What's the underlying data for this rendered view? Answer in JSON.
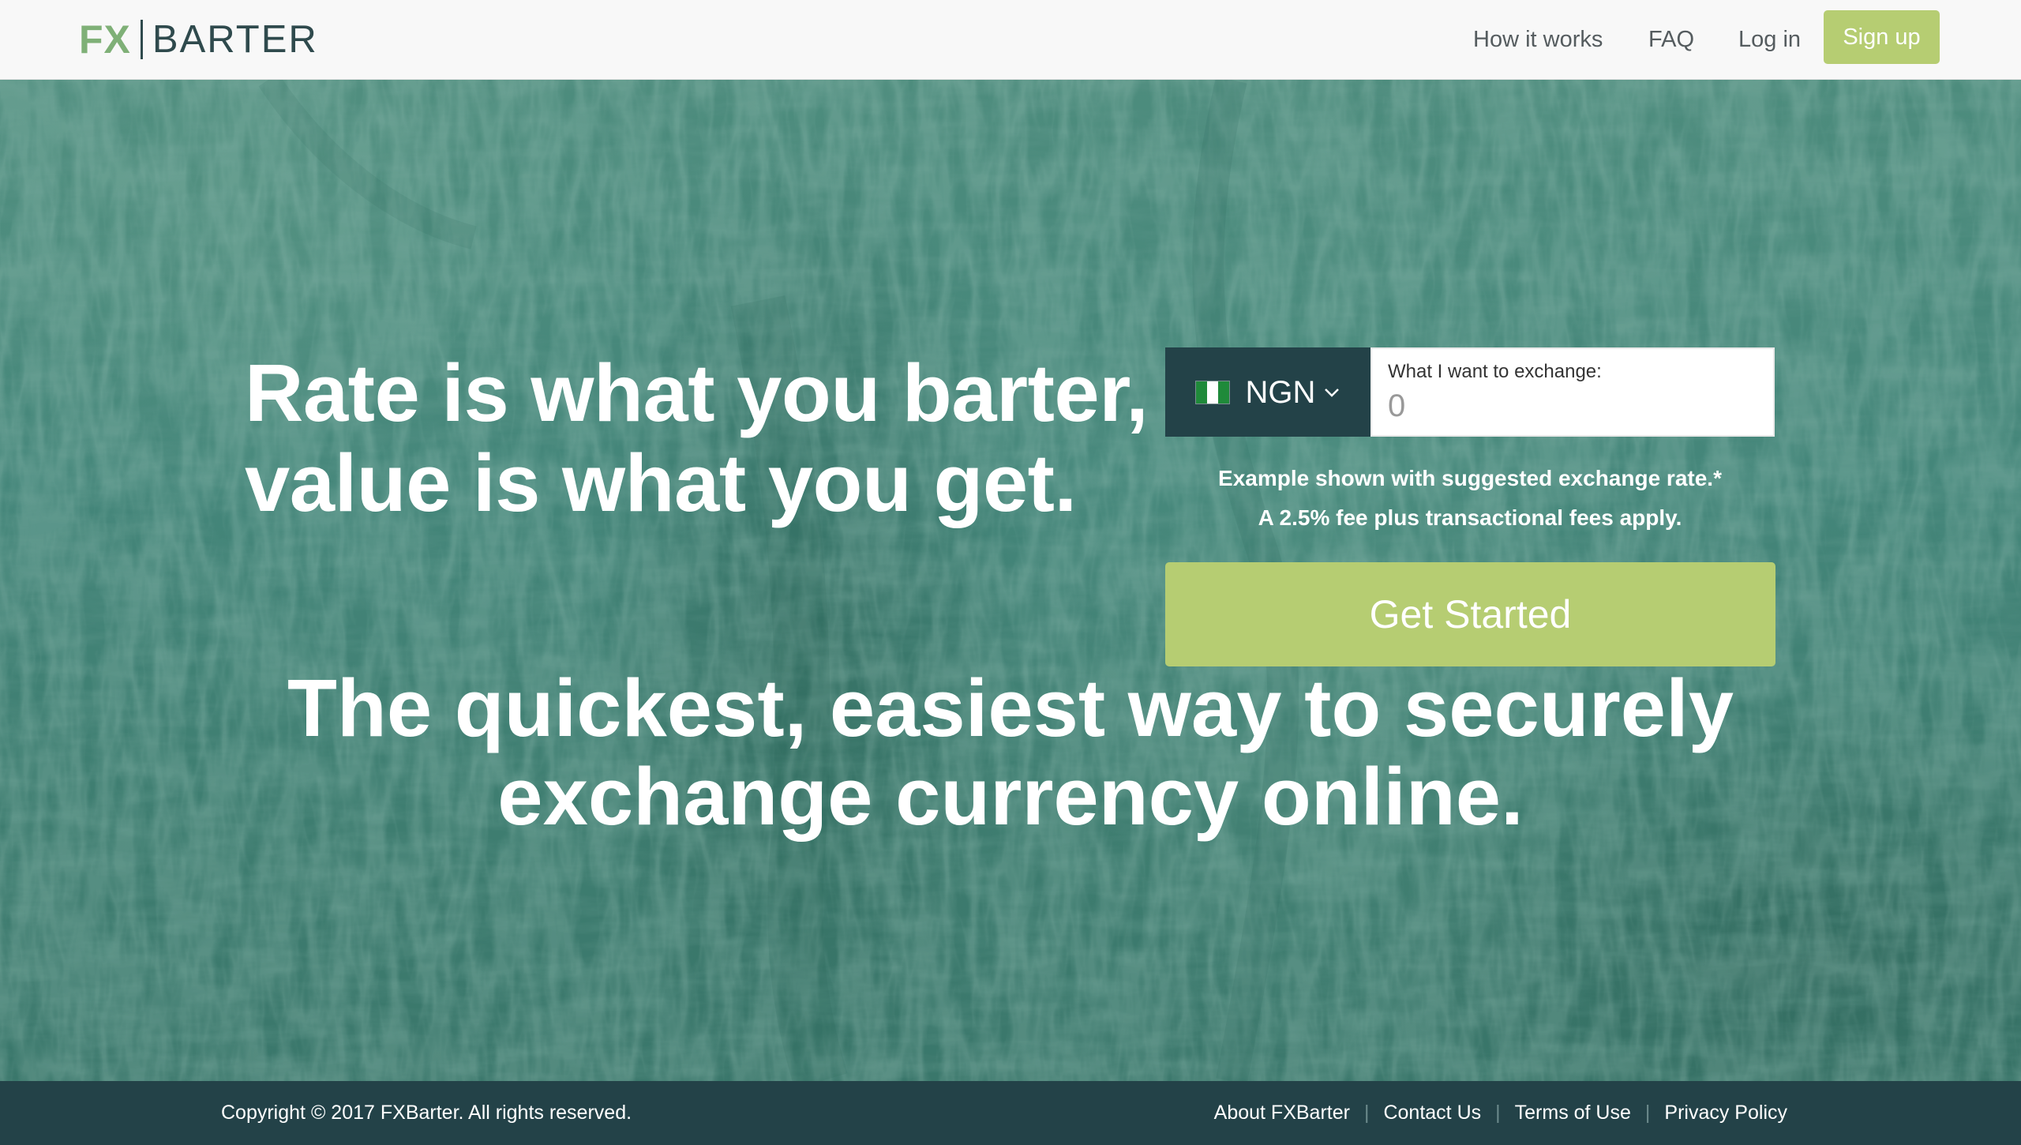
{
  "header": {
    "logo": {
      "fx": "FX",
      "barter": "BARTER"
    },
    "nav": {
      "how_it_works": "How it works",
      "faq": "FAQ",
      "login": "Log in",
      "signup": "Sign up"
    }
  },
  "hero": {
    "headline": [
      "Rate is what you barter,",
      "value is what you get."
    ],
    "exchange": {
      "currency": "NGN",
      "currency_flag": "nigeria-flag-icon",
      "amount_label": "What I want to exchange:",
      "amount_placeholder": "0"
    },
    "notes": [
      "Example shown with suggested exchange rate.*",
      "A 2.5% fee plus transactional fees apply."
    ],
    "cta": "Get Started",
    "tagline": [
      "The quickest, easiest way to securely",
      "exchange currency online."
    ]
  },
  "footer": {
    "copyright": "Copyright © 2017 FXBarter. All rights reserved.",
    "links": [
      "About FXBarter",
      "Contact Us",
      "Terms of Use",
      "Privacy Policy"
    ]
  },
  "colors": {
    "accent": "#b6cd72",
    "dark": "#234248",
    "hero": "#44867a"
  }
}
